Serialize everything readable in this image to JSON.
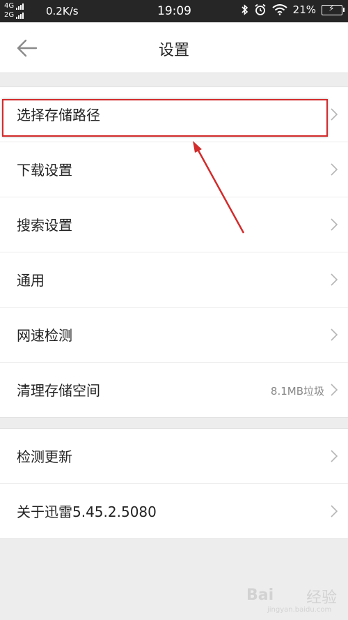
{
  "status_bar": {
    "net_top": "4G",
    "net_bottom": "2G",
    "speed": "0.2K/s",
    "time": "19:09",
    "battery": "21%",
    "icons": [
      "bluetooth-icon",
      "alarm-icon",
      "wifi-icon",
      "battery-icon"
    ]
  },
  "header": {
    "title": "设置",
    "back_icon": "arrow-left-icon"
  },
  "group1": [
    {
      "label": "选择存储路径",
      "value": ""
    },
    {
      "label": "下载设置",
      "value": ""
    },
    {
      "label": "搜索设置",
      "value": ""
    },
    {
      "label": "通用",
      "value": ""
    },
    {
      "label": "网速检测",
      "value": ""
    },
    {
      "label": "清理存储空间",
      "value": "8.1MB垃圾"
    }
  ],
  "group2": [
    {
      "label": "检测更新",
      "value": ""
    },
    {
      "label": "关于迅雷5.45.2.5080",
      "value": ""
    }
  ],
  "watermark": {
    "logo": "Bai",
    "logo2": "经验",
    "url": "jingyan.baidu.com"
  },
  "colors": {
    "accent_red": "#d22b2b",
    "background": "#ededed",
    "status_bar": "#262626"
  }
}
